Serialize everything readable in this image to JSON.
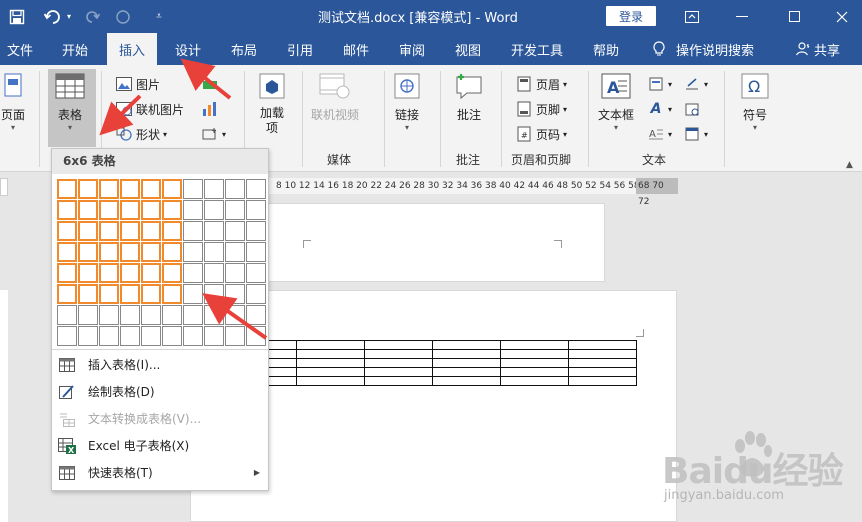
{
  "title_bar": {
    "doc_title": "测试文档.docx [兼容模式]  -  Word",
    "login_label": "登录",
    "colors": {
      "accent": "#2b579a"
    }
  },
  "tabs": [
    {
      "label": "文件"
    },
    {
      "label": "开始"
    },
    {
      "label": "插入",
      "active": true
    },
    {
      "label": "设计"
    },
    {
      "label": "布局"
    },
    {
      "label": "引用"
    },
    {
      "label": "邮件"
    },
    {
      "label": "审阅"
    },
    {
      "label": "视图"
    },
    {
      "label": "开发工具"
    },
    {
      "label": "帮助"
    }
  ],
  "help_search": "操作说明搜索",
  "share_label": "共享",
  "ribbon": {
    "page_btn": "页面",
    "table_btn": "表格",
    "picture_btn": "图片",
    "online_picture_btn": "联机图片",
    "shapes_btn": "形状",
    "addin_btn": "加载项",
    "online_video_btn": "联机视频",
    "media_group": "媒体",
    "link_btn": "链接",
    "comment_btn": "批注",
    "comment_group": "批注",
    "header_btn": "页眉",
    "footer_btn": "页脚",
    "page_number_btn": "页码",
    "header_footer_group": "页眉和页脚",
    "textbox_btn": "文本框",
    "text_group": "文本",
    "symbol_btn": "符号"
  },
  "ruler": {
    "numbers": "8 10 12 14 16 18 20 22 24 26 28 30 32 34 36 38 40 42 44 46 48 50 52 54 56 58 60 62 64",
    "end_numbers": "68 70 72"
  },
  "table_dropdown": {
    "header": "6x6 表格",
    "grid_cols": 10,
    "grid_rows": 8,
    "selected_cols": 6,
    "selected_rows": 6,
    "items": [
      {
        "label": "插入表格(I)...",
        "icon": "table-grid-icon",
        "disabled": false
      },
      {
        "label": "绘制表格(D)",
        "icon": "draw-table-pencil-icon",
        "disabled": false
      },
      {
        "label": "文本转换成表格(V)...",
        "icon": "text-to-table-icon",
        "disabled": true
      },
      {
        "label": "Excel 电子表格(X)",
        "icon": "excel-icon",
        "disabled": false
      },
      {
        "label": "快速表格(T)",
        "icon": "quick-table-icon",
        "disabled": false,
        "submenu": true
      }
    ],
    "selection_color": "#f08a2c"
  },
  "watermark": {
    "brand": "Baidu经验",
    "sub": "jingyan.baidu.com"
  },
  "annotation_color": "#e8413a"
}
